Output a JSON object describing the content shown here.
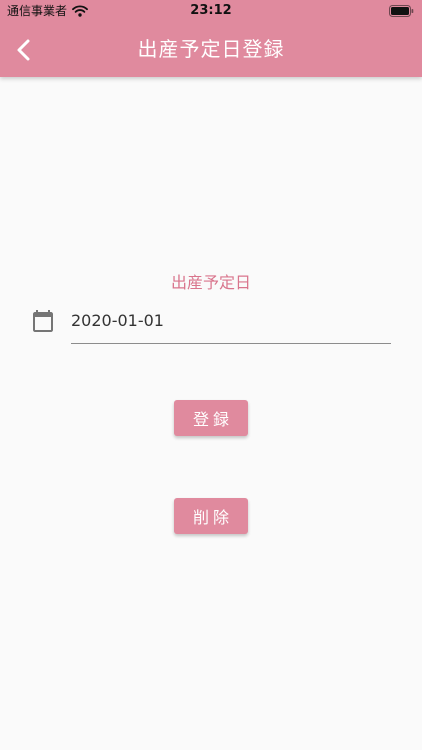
{
  "status_bar": {
    "carrier": "通信事業者",
    "time": "23:12"
  },
  "header": {
    "title": "出産予定日登録",
    "back_icon": "chevron-left-icon"
  },
  "form": {
    "label": "出産予定日",
    "date_value": "2020-01-01",
    "date_icon": "calendar-icon"
  },
  "buttons": {
    "register_label": "登録",
    "delete_label": "削除"
  },
  "colors": {
    "accent": "#e08a9e",
    "label_text": "#d9758d",
    "background": "#fafafa"
  }
}
